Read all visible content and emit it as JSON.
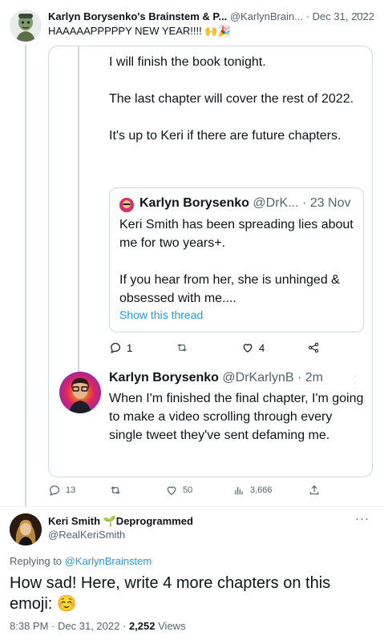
{
  "tweet1": {
    "author_name": "Karlyn Borysenko's Brainstem & P...",
    "handle": "@KarlynBrain...",
    "separator": "·",
    "date": "Dec 31, 2022",
    "text": "HAAAAAPPPPPY NEW YEAR!!!! 🙌🎉",
    "more_label": "···",
    "actions": {
      "replies": "13",
      "retweets": "",
      "likes": "50",
      "views": "3,666"
    }
  },
  "screenshot": {
    "paragraphs": [
      "I will finish the book tonight.",
      "The last chapter will cover the rest of 2022.",
      "It's up to Keri if there are future chapters."
    ],
    "quote": {
      "name": "Karlyn Borysenko",
      "handle": "@DrK...",
      "separator": "·",
      "date": "23 Nov",
      "paragraphs": [
        "Keri Smith has been spreading lies about me for two years+.",
        "If you hear from her, she is unhinged & obsessed with me...."
      ],
      "show_thread": "Show this thread"
    },
    "actions": {
      "replies": "1",
      "retweets": "",
      "likes": "4"
    },
    "reply": {
      "name": "Karlyn Borysenko",
      "handle": "@DrKarlynB",
      "separator": "·",
      "time": "2m",
      "text": "When I'm finished the final chapter, I'm going to make a video scrolling through every single tweet they've sent defaming me."
    }
  },
  "tweet2": {
    "author_name": "Keri Smith 🌱Deprogrammed",
    "handle": "@RealKeriSmith",
    "more_label": "···",
    "replying_prefix": "Replying to",
    "replying_to": "@KarlynBrainstem",
    "text": "How sad! Here, write 4 more chapters on this emoji: ☺️",
    "time": "8:38 PM",
    "separator": "·",
    "date": "Dec 31, 2022",
    "separator2": "·",
    "views": "2,252",
    "views_label": "Views"
  },
  "colors": {
    "accent": "#1d9bf0",
    "muted": "#536471",
    "border": "#cfd9de"
  }
}
